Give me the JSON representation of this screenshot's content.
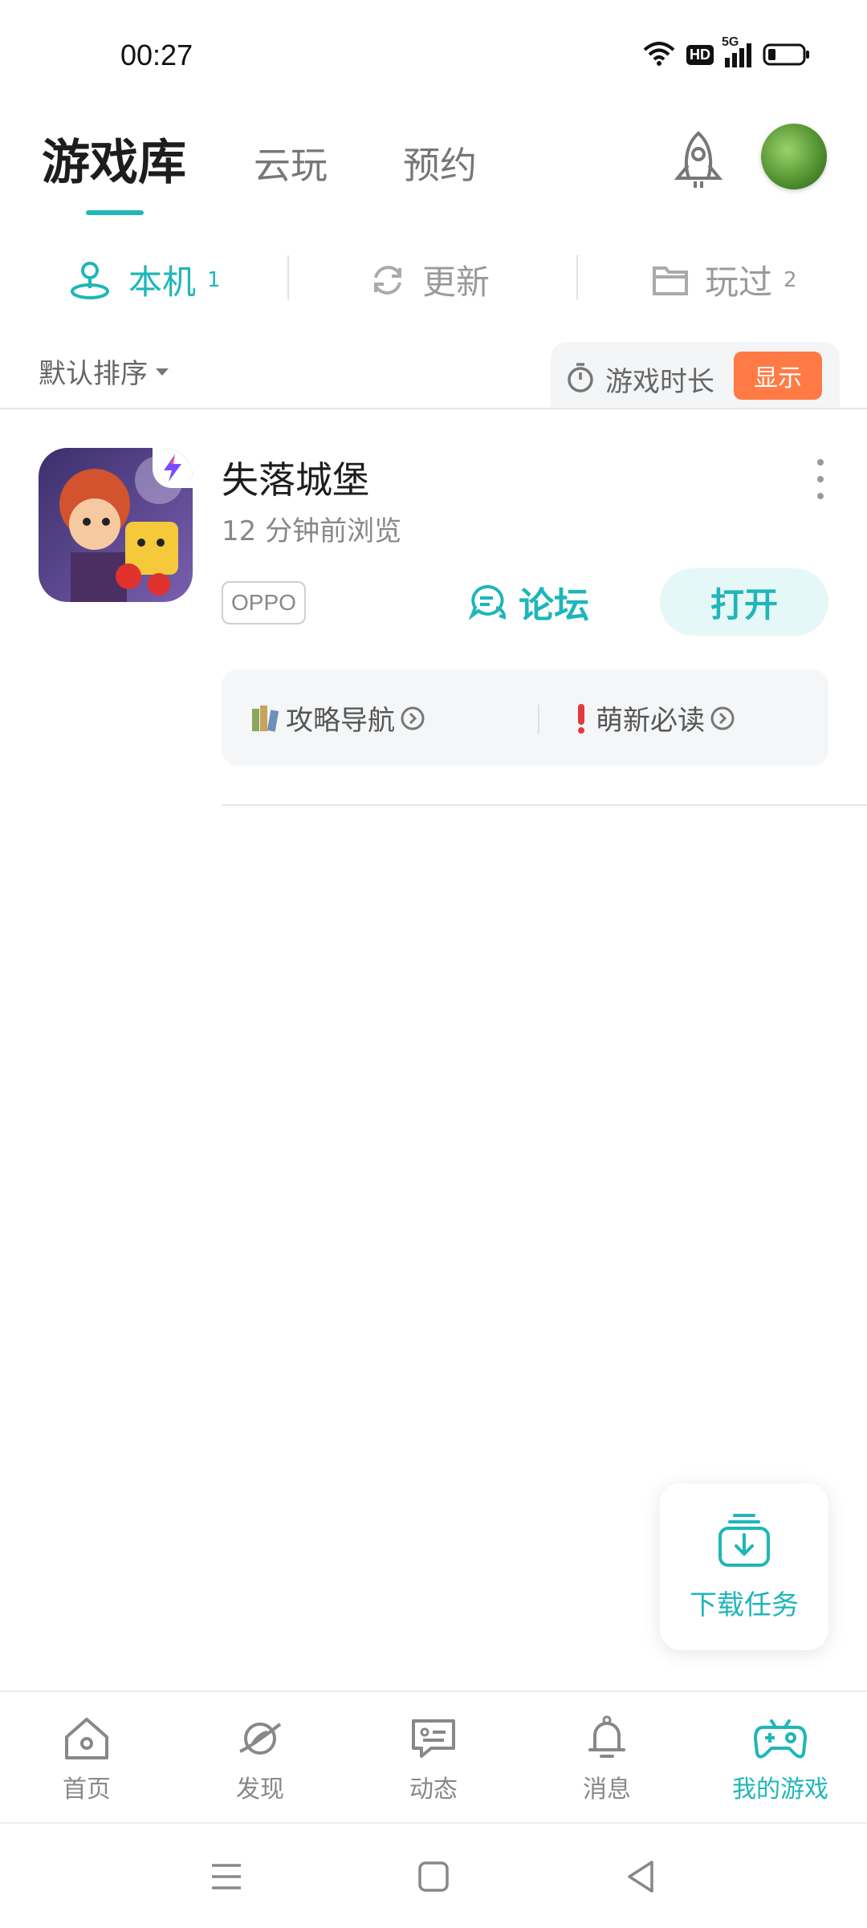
{
  "status_bar": {
    "time": "00:27",
    "icons": [
      "wifi-icon",
      "hd-icon",
      "signal-5g-icon",
      "battery-icon"
    ],
    "network_label": "5G",
    "hd_label": "HD"
  },
  "header": {
    "tabs": [
      {
        "label": "游戏库",
        "active": true
      },
      {
        "label": "云玩",
        "active": false
      },
      {
        "label": "预约",
        "active": false
      }
    ],
    "accent_color": "#1fb6b9"
  },
  "sub_tabs": [
    {
      "label": "本机",
      "count": "1",
      "active": true
    },
    {
      "label": "更新",
      "count": "",
      "active": false
    },
    {
      "label": "玩过",
      "count": "2",
      "active": false
    }
  ],
  "sort": {
    "label": "默认排序"
  },
  "game_duration": {
    "label": "游戏时长",
    "button": "显示",
    "button_color": "#ff7a45"
  },
  "games": [
    {
      "title": "失落城堡",
      "subtitle": "12 分钟前浏览",
      "badge": "OPPO",
      "forum_label": "论坛",
      "open_label": "打开",
      "links": [
        {
          "label": "攻略导航",
          "icon": "books-icon"
        },
        {
          "label": "萌新必读",
          "icon": "exclamation-icon"
        }
      ]
    }
  ],
  "floating": {
    "download_label": "下载任务"
  },
  "bottom_nav": [
    {
      "label": "首页",
      "icon": "home-icon",
      "active": false
    },
    {
      "label": "发现",
      "icon": "planet-icon",
      "active": false
    },
    {
      "label": "动态",
      "icon": "chat-icon",
      "active": false
    },
    {
      "label": "消息",
      "icon": "bell-icon",
      "active": false
    },
    {
      "label": "我的游戏",
      "icon": "gamepad-icon",
      "active": true
    }
  ]
}
